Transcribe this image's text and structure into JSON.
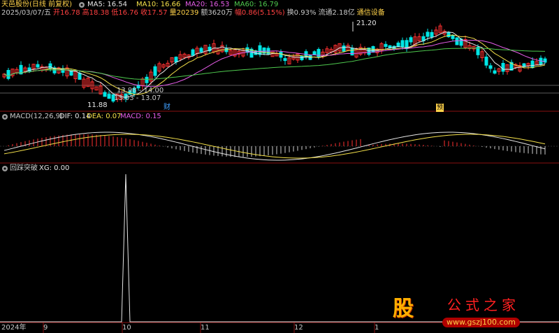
{
  "header": {
    "stock": "天邑股份(日线 前复权)",
    "ma": [
      {
        "label": "MA5: 16.54",
        "color": "#e6e6e6"
      },
      {
        "label": "MA10: 16.66",
        "color": "#f5e14a"
      },
      {
        "label": "MA20: 16.53",
        "color": "#e55ce8"
      },
      {
        "label": "MA60: 16.79",
        "color": "#4ec94e"
      }
    ],
    "info": [
      {
        "label": "2025/03/07/五",
        "color": "#c8c8c8"
      },
      {
        "label": "开16.78",
        "color": "#ff4040"
      },
      {
        "label": "高18.38",
        "color": "#ff4040"
      },
      {
        "label": "低16.76",
        "color": "#ff4040"
      },
      {
        "label": "收17.57",
        "color": "#ff4040"
      },
      {
        "label": "量20239",
        "color": "#ffd24a"
      },
      {
        "label": "额3620万",
        "color": "#c8c8c8"
      },
      {
        "label": "幅0.86(5.15%)",
        "color": "#ff4040"
      },
      {
        "label": "换0.93%",
        "color": "#c8c8c8"
      },
      {
        "label": "流通2.18亿",
        "color": "#c8c8c8"
      },
      {
        "label": "通信设备",
        "color": "#ffd24a"
      }
    ]
  },
  "price_annotations": {
    "high": "21.20",
    "low": "11.88",
    "range1": "13.98 - 14.00",
    "range2": "13.03 - 13.07",
    "marker1": "财",
    "marker2": "预"
  },
  "macd": {
    "title": "MACD(12,26,9)",
    "dif": "DIF: 0.14",
    "dea": "DEA: 0.07",
    "macd": "MACD: 0.15"
  },
  "indicator": {
    "title": "回踩突破",
    "xg": "XG: 0.00"
  },
  "timeline": [
    "2024年",
    "9",
    "10",
    "11",
    "12",
    "1"
  ],
  "watermark": {
    "glyph": "股",
    "name": "公式之家",
    "url": "www.gszj100.com"
  },
  "colors": {
    "up": "#ff3030",
    "down": "#00e5e5",
    "ma5": "#e6e6e6",
    "ma10": "#f5e14a",
    "ma20": "#e55ce8",
    "ma60": "#4ec94e",
    "grid": "#8a1010"
  }
}
